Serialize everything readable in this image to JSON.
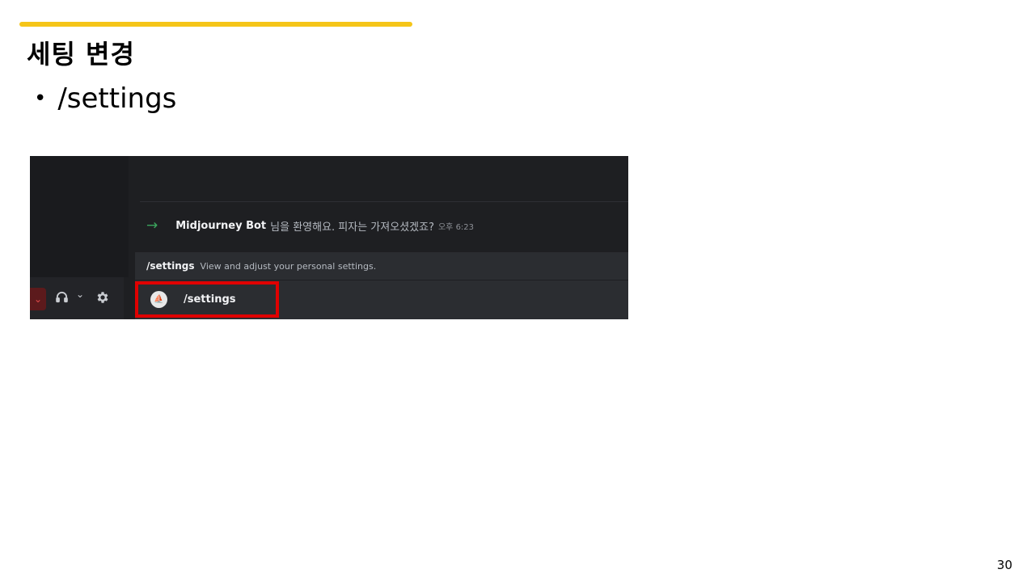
{
  "slide": {
    "title": "세팅 변경",
    "bullet": "/settings",
    "page_number": "30",
    "accent_color": "#f5c518"
  },
  "screenshot": {
    "welcome": {
      "arrow_icon": "join-arrow-icon",
      "bot_name": "Midjourney Bot",
      "message": "님을 환영해요. 피자는 가져오셨겠죠?",
      "time": "오후 6:23"
    },
    "autocomplete": {
      "command": "/settings",
      "description": "View and adjust your personal settings."
    },
    "input": {
      "command": "/settings",
      "highlight_color": "#e00000"
    },
    "user_panel": {
      "icons": [
        "chevron-down-icon",
        "headphones-icon",
        "settings-gear-icon"
      ]
    }
  }
}
